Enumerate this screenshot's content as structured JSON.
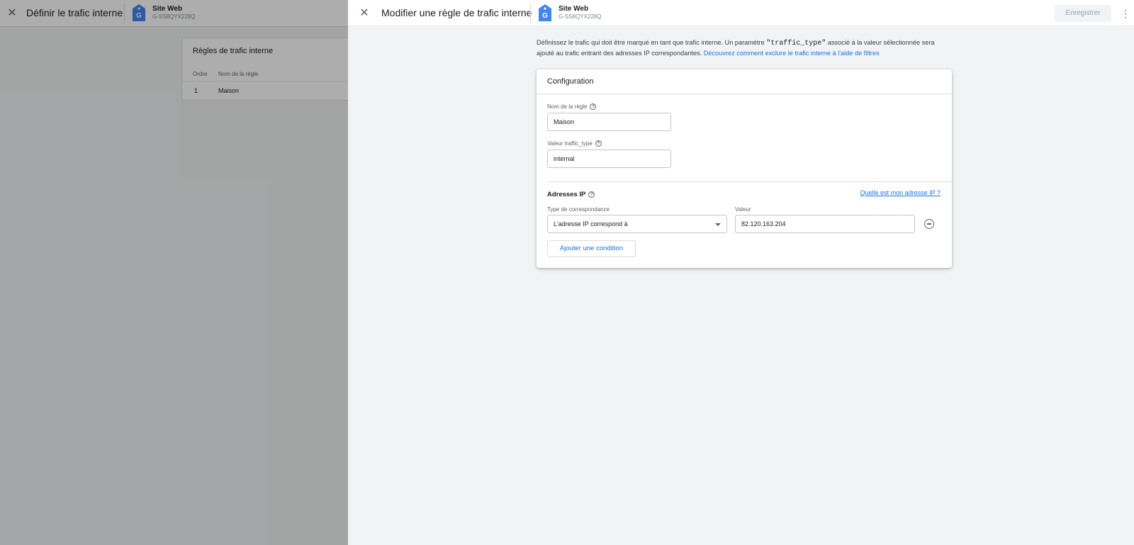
{
  "background": {
    "title": "Définir le trafic interne",
    "property": {
      "name": "Site Web",
      "id": "G-SS8QYX228Q"
    },
    "rules_card": {
      "title": "Règles de trafic interne",
      "columns": [
        "Ordre",
        "Nom de la règle"
      ],
      "rows": [
        {
          "order": "1",
          "name": "Maison"
        }
      ]
    }
  },
  "drawer": {
    "title": "Modifier une règle de trafic interne",
    "property": {
      "name": "Site Web",
      "id": "G-SS8QYX228Q"
    },
    "save_label": "Enregistrer",
    "description": {
      "part1": "Définissez le trafic qui doit être marqué en tant que trafic interne. Un paramètre ",
      "code": "\"traffic_type\"",
      "part2": " associé à la valeur sélectionnée sera ajouté au trafic entrant des adresses IP correspondantes. ",
      "link": "Découvrez comment exclure le trafic interne à l'aide de filtres"
    },
    "config": {
      "title": "Configuration",
      "rule_name_label": "Nom de la règle",
      "rule_name_value": "Maison",
      "traffic_type_label": "Valeur traffic_type",
      "traffic_type_value": "internal",
      "ip_section_title": "Adresses IP",
      "which_ip_link": "Quelle est mon adresse IP ?",
      "match_type_label": "Type de correspondance",
      "match_type_value": "L'adresse IP correspond à",
      "value_label": "Valeur",
      "value_value": "82.120.163.204",
      "add_condition_label": "Ajouter une condition"
    }
  },
  "colors": {
    "accent": "#1a73e8",
    "tag_icon": "#4285f4"
  },
  "icons": [
    "close-icon",
    "tag-icon",
    "help-icon",
    "chevron-down-icon",
    "remove-circle-icon",
    "more-vert-icon"
  ]
}
